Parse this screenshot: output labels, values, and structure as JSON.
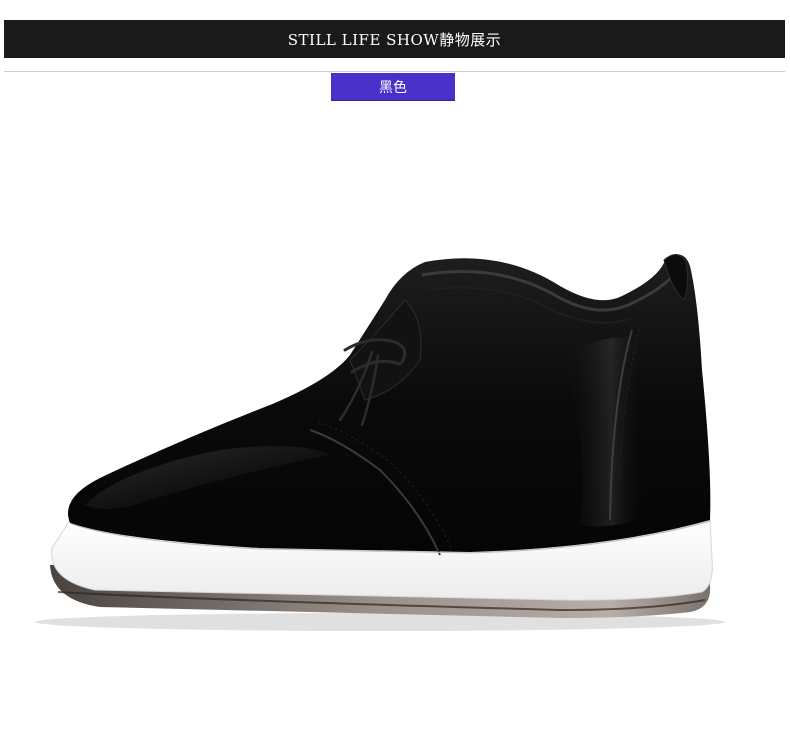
{
  "header": {
    "title": "STILL LIFE SHOW静物展示"
  },
  "color_tag": {
    "label": "黑色",
    "background": "#4830c8"
  },
  "product": {
    "icon": "black-leather-lace-up-wedge-sneaker",
    "upper_color": "#0c0c0c",
    "midsole_color": "#ffffff",
    "outsole_color": "#8a7f78"
  }
}
